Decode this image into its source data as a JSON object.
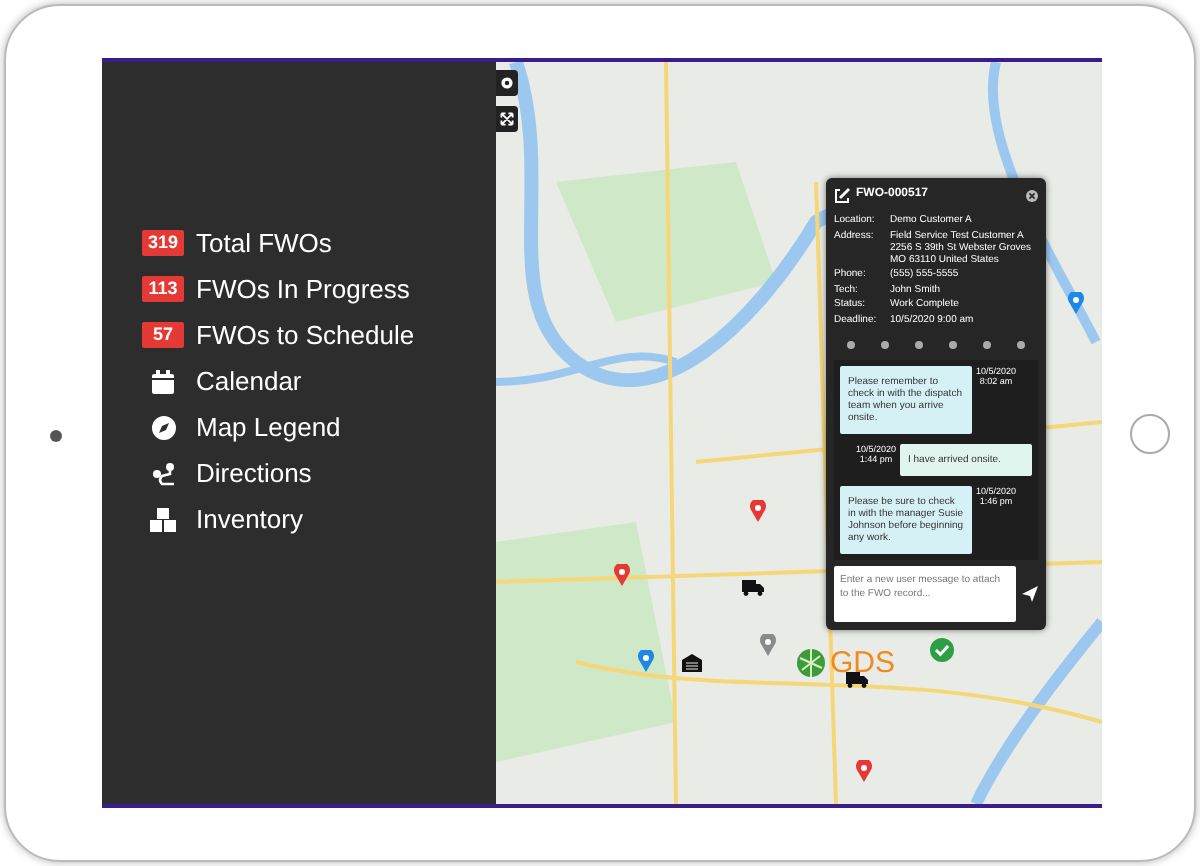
{
  "menu": [
    {
      "kind": "badge",
      "badge": "319",
      "label": "Total FWOs"
    },
    {
      "kind": "badge",
      "badge": "113",
      "label": "FWOs In Progress"
    },
    {
      "kind": "badge",
      "badge": "57",
      "label": "FWOs to Schedule"
    },
    {
      "kind": "calendar",
      "label": "Calendar"
    },
    {
      "kind": "compass",
      "label": "Map Legend"
    },
    {
      "kind": "route",
      "label": "Directions"
    },
    {
      "kind": "boxes",
      "label": "Inventory"
    }
  ],
  "map": {
    "logo": "GDS",
    "markers": [
      {
        "kind": "pin",
        "color": "#e53935"
      },
      {
        "kind": "pin",
        "color": "#e53935"
      },
      {
        "kind": "pin",
        "color": "#e53935"
      },
      {
        "kind": "pin",
        "color": "#1e88e5"
      },
      {
        "kind": "pin",
        "color": "#1e88e5"
      },
      {
        "kind": "pin",
        "color": "#8a8a8a"
      },
      {
        "kind": "truck",
        "color": "#111111"
      },
      {
        "kind": "truck",
        "color": "#111111"
      },
      {
        "kind": "warehouse",
        "color": "#111111"
      },
      {
        "kind": "check",
        "color": "#2e9e44"
      }
    ]
  },
  "popup": {
    "title": "FWO-000517",
    "fields": [
      {
        "label": "Location:",
        "value": "Demo Customer A"
      },
      {
        "label": "Address:",
        "value": "Field Service Test Customer A 2256 S 39th St Webster Groves MO 63110 United States"
      },
      {
        "label": "Phone:",
        "value": "(555) 555-5555"
      },
      {
        "label": "Tech:",
        "value": "John Smith"
      },
      {
        "label": "Status:",
        "value": "Work Complete"
      },
      {
        "label": "Deadline:",
        "value": "10/5/2020 9:00 am"
      }
    ],
    "messages": [
      {
        "kind": "received",
        "text": "Please remember to check in with the dispatch team when you arrive onsite.",
        "date": "10/5/2020",
        "time": "8:02 am"
      },
      {
        "kind": "sent",
        "text": "I have arrived onsite.",
        "date": "10/5/2020",
        "time": "1:44 pm"
      },
      {
        "kind": "received",
        "text": "Please be sure to check in with the manager Susie Johnson before beginning any work.",
        "date": "10/5/2020",
        "time": "1:46 pm"
      }
    ],
    "input": {
      "placeholder": "Enter a new user message to attach to the FWO record..."
    }
  }
}
